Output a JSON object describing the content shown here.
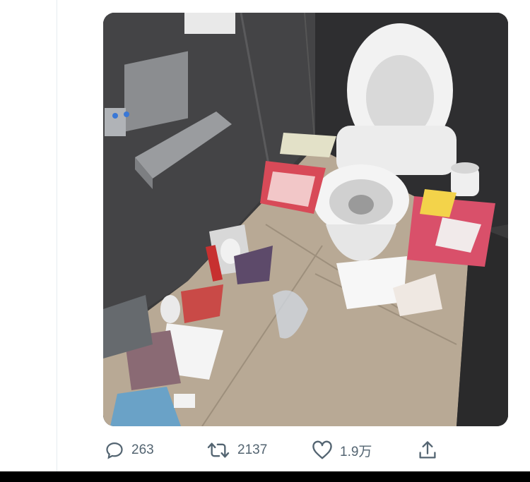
{
  "tweet": {
    "media": {
      "icon": "photo-restroom-scene"
    },
    "actions": {
      "reply": {
        "icon": "reply-icon",
        "count": "263"
      },
      "retweet": {
        "icon": "retweet-icon",
        "count": "2137"
      },
      "like": {
        "icon": "heart-icon",
        "count": "1.9万"
      },
      "share": {
        "icon": "share-icon"
      }
    }
  },
  "colors": {
    "action_gray": "#536471",
    "divider": "#e6ecf0",
    "bottom_bar": "#000000"
  }
}
